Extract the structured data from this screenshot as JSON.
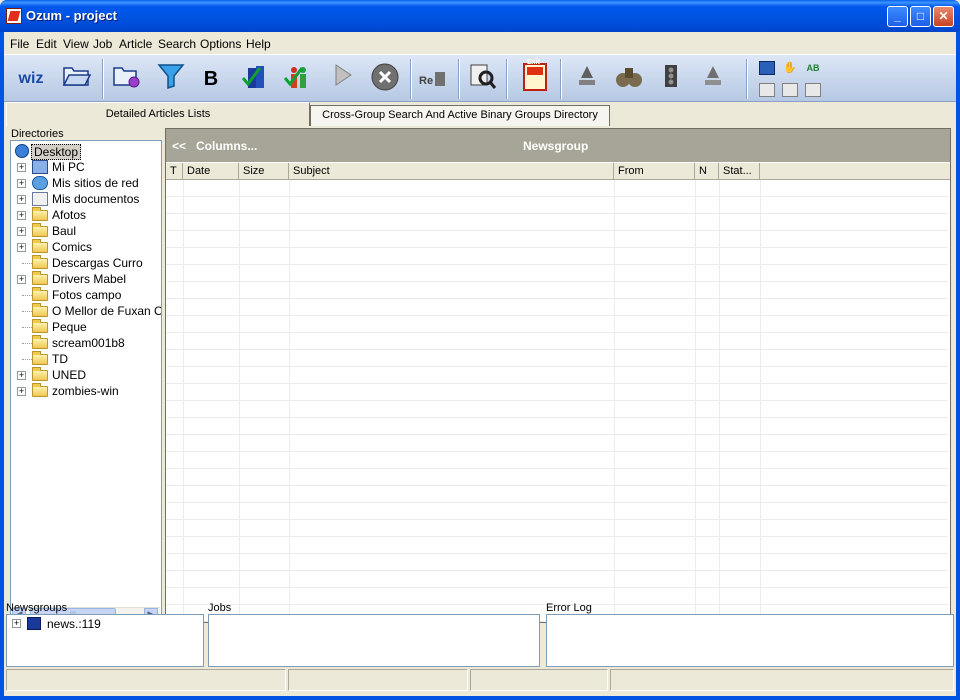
{
  "window": {
    "title": "Ozum - project"
  },
  "menu": [
    "File",
    "Edit",
    "View",
    "Job",
    "Article",
    "Search",
    "Options",
    "Help"
  ],
  "toolbar": {
    "wizard": "wiz",
    "bold": "B",
    "exit": "Exit"
  },
  "tabs": {
    "active": "Detailed Articles Lists",
    "inactive": "Cross-Group Search And Active Binary Groups Directory"
  },
  "directories": {
    "label": "Directories",
    "root": "Desktop",
    "items": [
      {
        "label": "Mi PC",
        "expandable": true,
        "icon": "computer-icon"
      },
      {
        "label": "Mis sitios de red",
        "expandable": true,
        "icon": "network-icon"
      },
      {
        "label": "Mis documentos",
        "expandable": true,
        "icon": "documents-icon"
      },
      {
        "label": "Afotos",
        "expandable": true,
        "icon": "folder-icon"
      },
      {
        "label": "Baul",
        "expandable": true,
        "icon": "folder-icon"
      },
      {
        "label": "Comics",
        "expandable": true,
        "icon": "folder-icon"
      },
      {
        "label": "Descargas Curro",
        "expandable": false,
        "icon": "folder-icon"
      },
      {
        "label": "Drivers Mabel",
        "expandable": true,
        "icon": "folder-icon"
      },
      {
        "label": "Fotos campo",
        "expandable": false,
        "icon": "folder-icon"
      },
      {
        "label": "O Mellor de Fuxan Os",
        "expandable": false,
        "icon": "folder-icon"
      },
      {
        "label": "Peque",
        "expandable": false,
        "icon": "folder-icon"
      },
      {
        "label": "scream001b8",
        "expandable": false,
        "icon": "folder-icon"
      },
      {
        "label": "TD",
        "expandable": false,
        "icon": "folder-icon"
      },
      {
        "label": "UNED",
        "expandable": true,
        "icon": "folder-icon"
      },
      {
        "label": "zombies-win",
        "expandable": true,
        "icon": "folder-icon"
      }
    ]
  },
  "articles": {
    "back": "<<",
    "columns": "Columns...",
    "newsgroup": "Newsgroup",
    "headers": [
      "T",
      "Date",
      "Size",
      "Subject",
      "From",
      "N",
      "Stat..."
    ]
  },
  "bottom": {
    "newsgroups_label": "Newsgroups",
    "newsgroup_item": "news.:119",
    "jobs_label": "Jobs",
    "errorlog_label": "Error Log"
  }
}
